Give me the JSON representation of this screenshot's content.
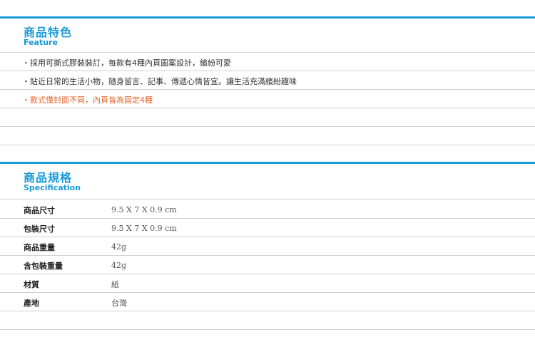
{
  "feature": {
    "title": "商品特色",
    "subtitle": "Feature",
    "items": [
      "・採用可撕式膠裝裝訂，每款有4種內頁圖案設計，繽紛可愛",
      "・貼近日常的生活小物，隨身留言、記事、傳遞心情皆宜。讓生活充滿繽紛趣味",
      "・款式僅封面不同，內頁皆為固定4種"
    ],
    "note_color": "#e6632a"
  },
  "specification": {
    "title": "商品規格",
    "subtitle": "Specification",
    "rows": [
      {
        "label": "商品尺寸",
        "value": "9.5 X 7 X 0.9 cm"
      },
      {
        "label": "包裝尺寸",
        "value": "9.5 X 7 X 0.9 cm"
      },
      {
        "label": "商品重量",
        "value": "42g"
      },
      {
        "label": "含包裝重量",
        "value": "42g"
      },
      {
        "label": "材質",
        "value": "紙"
      },
      {
        "label": "產地",
        "value": "台灣"
      }
    ]
  },
  "colors": {
    "accent": "#1a9ad8",
    "divider": "#cfcfcf"
  }
}
